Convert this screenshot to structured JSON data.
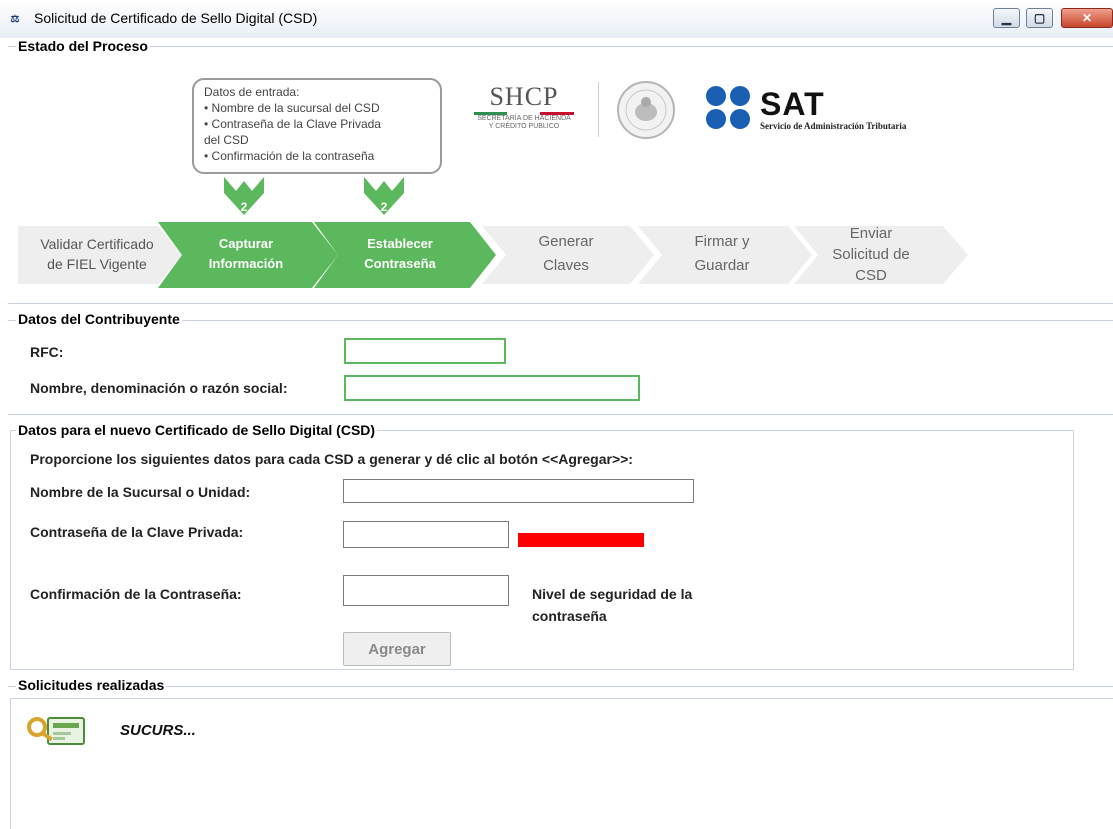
{
  "window": {
    "title": "Solicitud de Certificado de Sello Digital (CSD)",
    "icon": "sat-app-icon",
    "controls": {
      "minimize": "minimize-icon",
      "maximize": "maximize-icon",
      "close": "close-icon"
    }
  },
  "process": {
    "legend": "Estado del Proceso",
    "bubble_lines": [
      "Datos de entrada:",
      "• Nombre de la sucursal del CSD",
      "• Contraseña de la Clave Privada",
      "del CSD",
      "• Confirmación de la contraseña"
    ],
    "arrow_badges": [
      "2",
      "2"
    ],
    "steps": [
      {
        "label_line1": "Validar Certificado",
        "label_line2": "de FIEL Vigente",
        "label_line3": "",
        "state": "pending"
      },
      {
        "label_line1": "Capturar",
        "label_line2": "Información",
        "label_line3": "",
        "state": "active"
      },
      {
        "label_line1": "Establecer",
        "label_line2": "Contraseña",
        "label_line3": "",
        "state": "active"
      },
      {
        "label_line1": "Generar",
        "label_line2": "Claves",
        "label_line3": "",
        "state": "pending"
      },
      {
        "label_line1": "Firmar y",
        "label_line2": "Guardar",
        "label_line3": "",
        "state": "pending"
      },
      {
        "label_line1": "Enviar",
        "label_line2": "Solicitud de",
        "label_line3": "CSD",
        "state": "pending"
      }
    ],
    "logos": {
      "shcp_title": "SHCP",
      "shcp_sub_line1": "SECRETARÍA DE HACIENDA",
      "shcp_sub_line2": "Y CRÉDITO PÚBLICO",
      "sat_title": "SAT",
      "sat_sub": "Servicio de Administración Tributaria"
    }
  },
  "contributor": {
    "legend": "Datos del Contribuyente",
    "rfc_label": "RFC:",
    "rfc_value": "",
    "name_label": "Nombre, denominación o razón social:",
    "name_value": ""
  },
  "new_csd": {
    "legend": "Datos para el nuevo Certificado de Sello Digital (CSD)",
    "instructions": "Proporcione los siguientes datos para cada CSD a generar y dé clic al botón <<Agregar>>:",
    "branch_label": "Nombre de la Sucursal o Unidad:",
    "branch_value": "",
    "password_label": "Contraseña de la Clave Privada:",
    "password_value": "",
    "confirm_label": "Confirmación de la Contraseña:",
    "confirm_value": "",
    "strength_label_line1": "Nivel de seguridad de la",
    "strength_label_line2": "contraseña",
    "strength_level": 0.1,
    "add_button": "Agregar"
  },
  "requests": {
    "legend": "Solicitudes realizadas",
    "items": [
      {
        "label": "SUCURS...",
        "icon": "certificate-key-icon"
      }
    ]
  },
  "colors": {
    "step_active": "#5cb85c",
    "step_pending": "#eeeeee",
    "input_highlight": "#5cb85c",
    "strength_low": "#ff0000",
    "sat_blue": "#1a5fb4"
  }
}
